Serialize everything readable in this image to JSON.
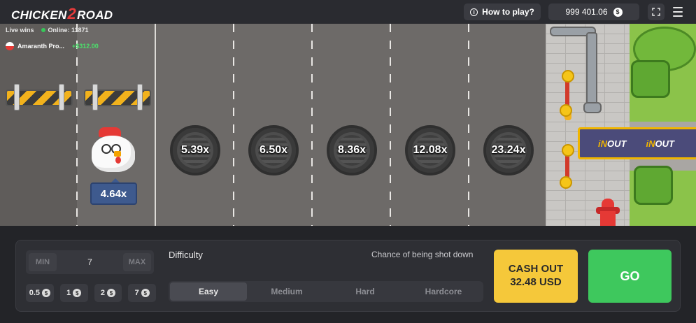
{
  "header": {
    "logo_pre": "CHICKEN",
    "logo_num": "2",
    "logo_post": "ROAD",
    "how_to_play": "How to play?",
    "balance": "999 401.06",
    "currency_symbol": "$"
  },
  "live": {
    "title": "Live wins",
    "online_label": "Online: 11871",
    "recent_win": {
      "player": "Amaranth Pro...",
      "amount": "+$312.00"
    }
  },
  "game": {
    "current_multiplier": "4.64x",
    "multipliers": [
      "5.39x",
      "6.50x",
      "8.36x",
      "12.08x",
      "23.24x"
    ],
    "banner_in": "iN",
    "banner_out": "OUT"
  },
  "panel": {
    "min_label": "MIN",
    "bet_value": "7",
    "max_label": "MAX",
    "quick_bets": [
      "0.5",
      "1",
      "2",
      "7"
    ],
    "difficulty_label": "Difficulty",
    "chance_label": "Chance of being shot down",
    "difficulties": [
      "Easy",
      "Medium",
      "Hard",
      "Hardcore"
    ],
    "active_difficulty": "Easy",
    "cashout_line1": "CASH OUT",
    "cashout_line2": "32.48 USD",
    "go_label": "GO"
  },
  "colors": {
    "accent_yellow": "#f5c83a",
    "go_green": "#3ec85d",
    "win_green": "#4be06b",
    "multiplier_blue": "#3e5a8e"
  }
}
